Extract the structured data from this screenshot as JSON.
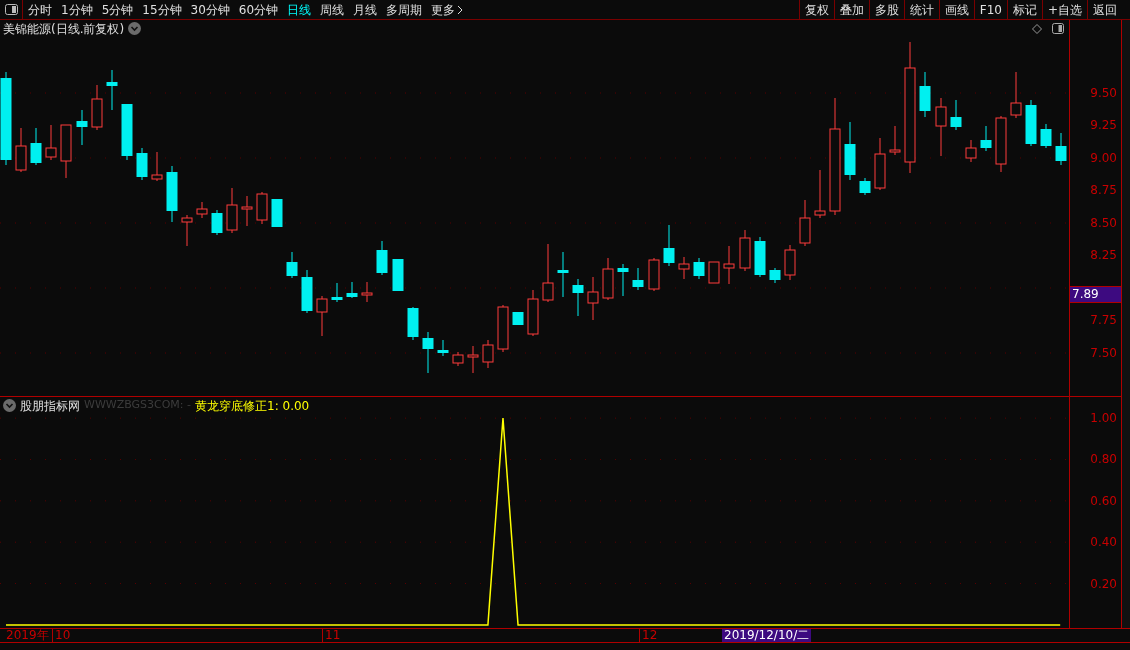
{
  "toolbar": {
    "periods": [
      {
        "label": "分时",
        "selected": false
      },
      {
        "label": "1分钟",
        "selected": false
      },
      {
        "label": "5分钟",
        "selected": false
      },
      {
        "label": "15分钟",
        "selected": false
      },
      {
        "label": "30分钟",
        "selected": false
      },
      {
        "label": "60分钟",
        "selected": false
      },
      {
        "label": "日线",
        "selected": true
      },
      {
        "label": "周线",
        "selected": false
      },
      {
        "label": "月线",
        "selected": false
      },
      {
        "label": "多周期",
        "selected": false
      },
      {
        "label": "更多",
        "selected": false
      }
    ],
    "actions": [
      "复权",
      "叠加",
      "多股",
      "统计",
      "画线",
      "F10",
      "标记",
      "+自选",
      "返回"
    ]
  },
  "main_chart": {
    "title": "美锦能源(日线.前复权)",
    "price_ticks": [
      "9.50",
      "9.25",
      "9.00",
      "8.75",
      "8.50",
      "8.25",
      "7.75",
      "7.50"
    ],
    "current_price": "7.89"
  },
  "indicator": {
    "name": "股朋指标网",
    "source": "WWWZBGS3COM: -",
    "reading": "黄龙穿底修正1: 0.00",
    "chart_data": {
      "type": "line",
      "series": [
        {
          "color": "#ffff00",
          "values": [
            0,
            0,
            0,
            0,
            0,
            0,
            0,
            0,
            0,
            0,
            0,
            0,
            0,
            0,
            0,
            0,
            0,
            0,
            0,
            0,
            0,
            0,
            0,
            0,
            0,
            0,
            0,
            0,
            0,
            0,
            0,
            0,
            0,
            1,
            0,
            0,
            0,
            0,
            0,
            0,
            0,
            0,
            0,
            0,
            0,
            0,
            0,
            0,
            0,
            0,
            0,
            0,
            0,
            0,
            0,
            0,
            0,
            0,
            0,
            0,
            0,
            0,
            0,
            0,
            0,
            0,
            0,
            0,
            0,
            0,
            0
          ]
        }
      ],
      "ylim": [
        -0.015,
        1.02
      ],
      "grid": true,
      "yticks": [
        {
          "value": 0.2,
          "label": "0.20"
        },
        {
          "value": 0.4,
          "label": "0.40"
        },
        {
          "value": 0.6,
          "label": "0.60"
        },
        {
          "value": 0.8,
          "label": "0.80"
        },
        {
          "value": 1,
          "label": "1.00"
        }
      ]
    }
  },
  "time_axis": {
    "year": "2019年",
    "months": [
      "10",
      "11",
      "12"
    ],
    "cursor_date": "2019/12/10/二"
  }
}
